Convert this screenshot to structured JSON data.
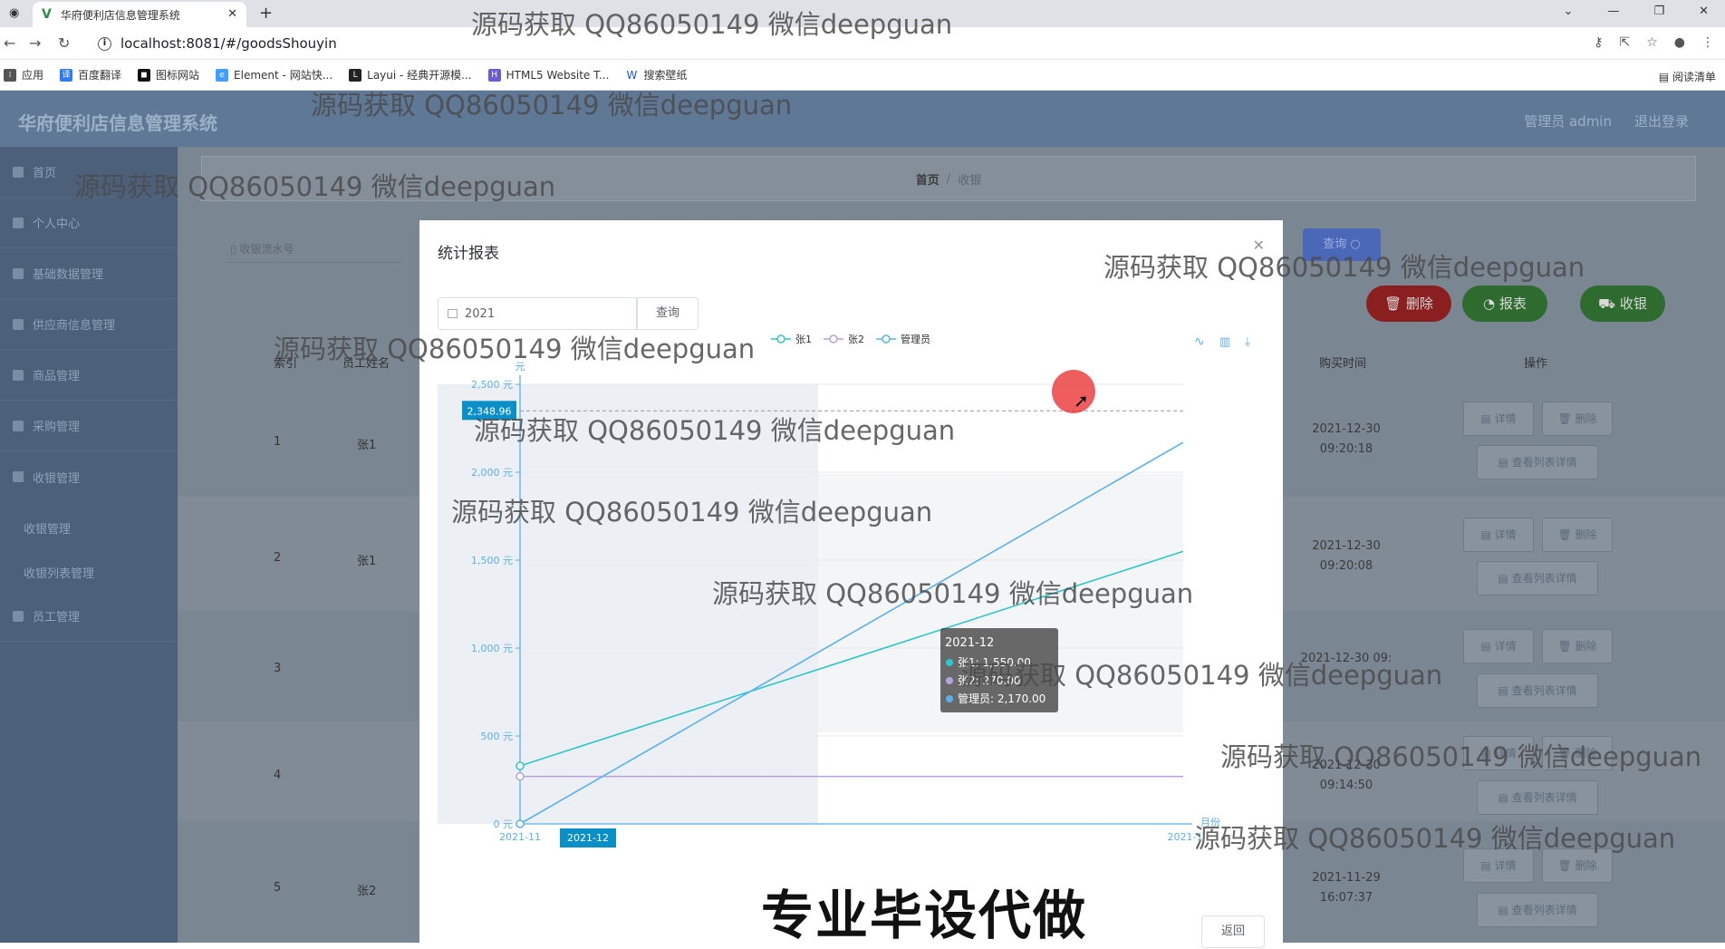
{
  "browser": {
    "tab_title": "华府便利店信息管理系统",
    "url": "localhost:8081/#/goodsShouyin",
    "bookmarks": [
      "应用",
      "百度翻译",
      "图标网站",
      "Element - 网站快...",
      "Layui - 经典开源模...",
      "HTML5 Website T...",
      "搜索壁纸"
    ],
    "reading_list": "阅读清单"
  },
  "app": {
    "title": "华府便利店信息管理系统",
    "user": "管理员 admin",
    "logout": "退出登录"
  },
  "sidebar": {
    "items": [
      "首页",
      "个人中心",
      "基础数据管理",
      "供应商信息管理",
      "商品管理",
      "采购管理",
      "收银管理",
      "员工管理"
    ],
    "sub_items": [
      "收银管理",
      "收银列表管理"
    ]
  },
  "breadcrumb": {
    "home": "首页",
    "sep": "/",
    "current": "收银"
  },
  "toolbar": {
    "search_placeholder": "收银流水号",
    "query": "查询",
    "delete": "删除",
    "report": "报表",
    "checkout": "收银"
  },
  "table": {
    "headers": [
      "索引",
      "员工姓名",
      "购买时间",
      "操作"
    ],
    "rows": [
      {
        "index": "1",
        "name": "张1",
        "time": "2021-12-30 09:20:18"
      },
      {
        "index": "2",
        "name": "张1",
        "time": "2021-12-30 09:20:08"
      },
      {
        "index": "3",
        "name": "",
        "time": "2021-12-30 09:"
      },
      {
        "index": "4",
        "name": "",
        "time": "2021-12-30 09:14:50"
      },
      {
        "index": "5",
        "name": "张2",
        "time": "2021-11-29 16:07:37"
      }
    ],
    "row_actions": {
      "detail": "详情",
      "delete": "删除",
      "list_detail": "查看列表详情"
    }
  },
  "modal": {
    "title": "统计报表",
    "year_value": "2021",
    "query": "查询",
    "back": "返回"
  },
  "chart_data": {
    "type": "line",
    "x": [
      "2021-11",
      "2021-12"
    ],
    "xlabel": "月份",
    "ylabel": "元",
    "ylim": [
      0,
      2500
    ],
    "yticks": [
      "0 元",
      "500 元",
      "1,000 元",
      "1,500 元",
      "2,000 元",
      "2,500 元"
    ],
    "series": [
      {
        "name": "张1",
        "values": [
          330,
          1550
        ],
        "color": "#2ec7c9"
      },
      {
        "name": "张2",
        "values": [
          270,
          270
        ],
        "color": "#b6a2de"
      },
      {
        "name": "管理员",
        "values": [
          0,
          2170
        ],
        "color": "#5ab1ef"
      }
    ],
    "pointer_value_label": "2,348.96",
    "x_edge_label": "2021-1",
    "axis_pointer_x_label": "2021-12",
    "tooltip": {
      "title": "2021-12",
      "lines": [
        "张1: 1,550.00",
        "张2: 270.00",
        "管理员: 2,170.00"
      ]
    },
    "toolbox": [
      "line-icon",
      "bar-icon",
      "download-icon"
    ],
    "legend_position": "top-center"
  },
  "watermarks": [
    "源码获取 QQ86050149 微信deepguan",
    "源码获取 QQ86050149 微信deepguan",
    "源码获取 QQ86050149 微信deepguan",
    "源码获取 QQ86050149 微信deepguan",
    "源码获取 QQ86050149 微信deepguan",
    "源码获取 QQ86050149 微信deepguan",
    "源码获取 QQ86050149 微信deepguan",
    "源码获取 QQ86050149 微信deepguan",
    "源码获取 QQ86050149 微信deepguan",
    "源码获取 QQ86050149 微信deepguan",
    "源码获取 QQ86050149 微信deepguan"
  ],
  "promo": "专业毕设代做"
}
